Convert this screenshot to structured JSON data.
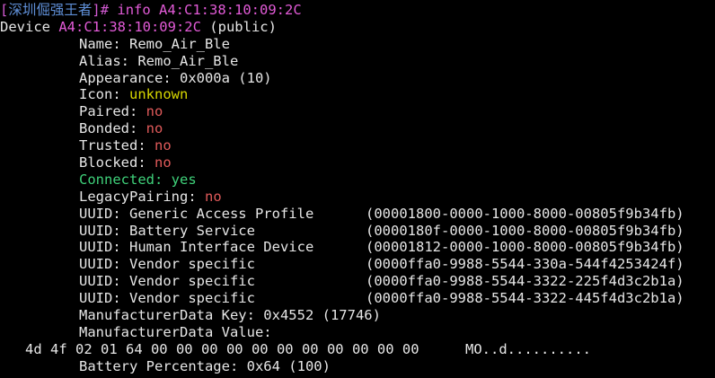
{
  "prompt": {
    "open": "[",
    "user": "深圳倔强王者",
    "close": "]# ",
    "command": "info A4:C1:38:10:09:2C"
  },
  "device": {
    "label": "Device ",
    "mac": "A4:C1:38:10:09:2C",
    "suffix": " (public)"
  },
  "fields": {
    "name": "Name: Remo_Air_Ble",
    "alias": "Alias: Remo_Air_Ble",
    "appearance": "Appearance: 0x000a (10)",
    "icon_key": "Icon: ",
    "icon_val": "unknown",
    "paired_key": "Paired: ",
    "paired_val": "no",
    "bonded_key": "Bonded: ",
    "bonded_val": "no",
    "trusted_key": "Trusted: ",
    "trusted_val": "no",
    "blocked_key": "Blocked: ",
    "blocked_val": "no",
    "connected_key": "Connected: ",
    "connected_val": "yes",
    "legacy_key": "LegacyPairing: ",
    "legacy_val": "no"
  },
  "uuids": [
    {
      "name": "UUID: Generic Access Profile",
      "value": "(00001800-0000-1000-8000-00805f9b34fb)"
    },
    {
      "name": "UUID: Battery Service",
      "value": "(0000180f-0000-1000-8000-00805f9b34fb)"
    },
    {
      "name": "UUID: Human Interface Device",
      "value": "(00001812-0000-1000-8000-00805f9b34fb)"
    },
    {
      "name": "UUID: Vendor specific",
      "value": "(0000ffa0-9988-5544-330a-544f4253424f)"
    },
    {
      "name": "UUID: Vendor specific",
      "value": "(0000ffa0-9988-5544-3322-225f4d3c2b1a)"
    },
    {
      "name": "UUID: Vendor specific",
      "value": "(0000ffa0-9988-5544-3322-445f4d3c2b1a)"
    }
  ],
  "manufacturer": {
    "key": "ManufacturerData Key: 0x4552 (17746)",
    "value_label": "ManufacturerData Value:",
    "hex": "4d 4f 02 01 64 00 00 00 00 00 00 00 00 00 00 00",
    "ascii": "MO..d.........."
  },
  "battery": "Battery Percentage: 0x64 (100)",
  "colors": {
    "background": "#000000",
    "text": "#e6e6e6",
    "magenta": "#e35bd8",
    "yellow": "#d7d700",
    "red": "#e05a5a",
    "green": "#3fd17a",
    "prompt_user": "#5f8fd7"
  }
}
